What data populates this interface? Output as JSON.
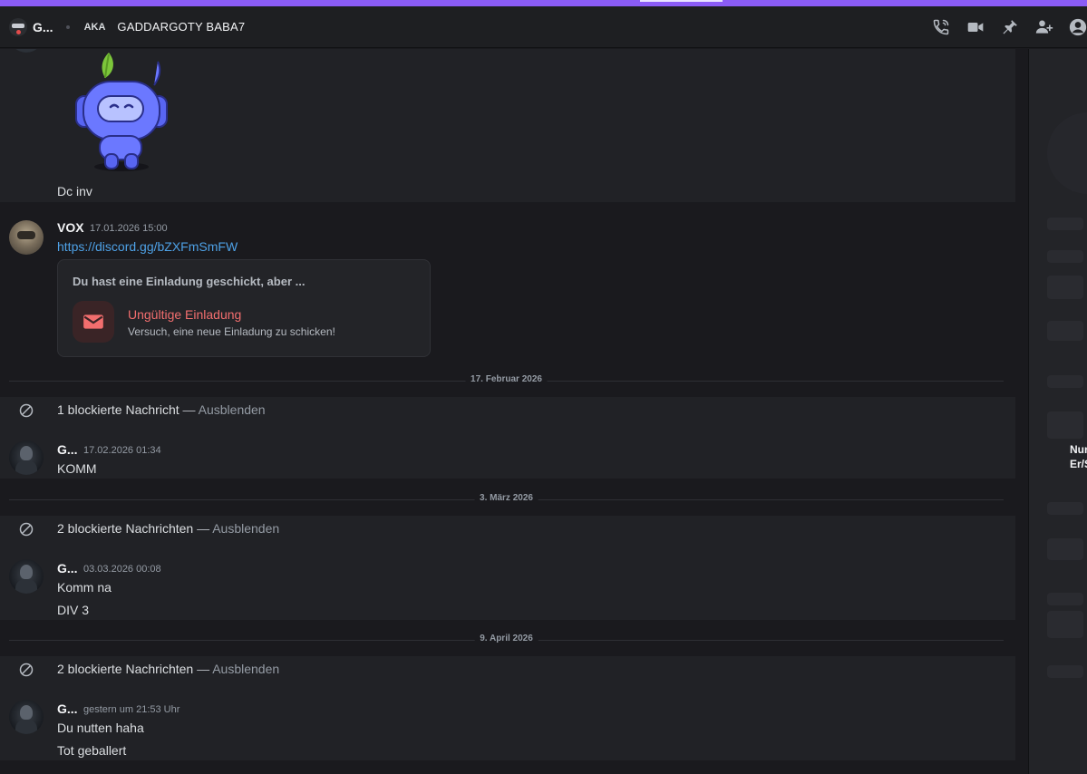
{
  "header": {
    "short_name": "G...",
    "aka_label": "AKA",
    "nickname": "GADDARGOTY BABA7",
    "icons": [
      "phone-icon",
      "video-icon",
      "pin-icon",
      "add-friend-icon",
      "profile-icon"
    ]
  },
  "messages": {
    "top": {
      "text": "Dc inv"
    },
    "vox": {
      "author": "VOX",
      "timestamp": "17.01.2026 15:00",
      "link": "https://discord.gg/bZXFmSmFW",
      "invite": {
        "title": "Du hast eine Einladung geschickt, aber ...",
        "error": "Ungültige Einladung",
        "subtitle": "Versuch, eine neue Einladung zu schicken!"
      }
    },
    "divider1": "17. Februar 2026",
    "blocked1": {
      "count_text": "1 blockierte Nachricht",
      "sep": " — ",
      "hide": "Ausblenden"
    },
    "g1": {
      "author": "G...",
      "timestamp": "17.02.2026 01:34",
      "lines": [
        "KOMM"
      ]
    },
    "divider2": "3. März 2026",
    "blocked2": {
      "count_text": "2 blockierte Nachrichten",
      "sep": " — ",
      "hide": "Ausblenden"
    },
    "g2": {
      "author": "G...",
      "timestamp": "03.03.2026 00:08",
      "lines": [
        "Komm na",
        "DIV 3"
      ]
    },
    "divider3": "9. April 2026",
    "blocked3": {
      "count_text": "2 blockierte Nachrichten",
      "sep": " — ",
      "hide": "Ausblenden"
    },
    "g3": {
      "author": "G...",
      "timestamp": "gestern um 21:53 Uhr",
      "lines": [
        "Du nutten haha",
        "Tot geballert"
      ]
    }
  },
  "right_panel": {
    "line1": "Nur",
    "line2": "Er/S"
  },
  "colors": {
    "accent": "#8b5cf6",
    "link": "#4ea1e6",
    "error": "#f26e6e"
  }
}
